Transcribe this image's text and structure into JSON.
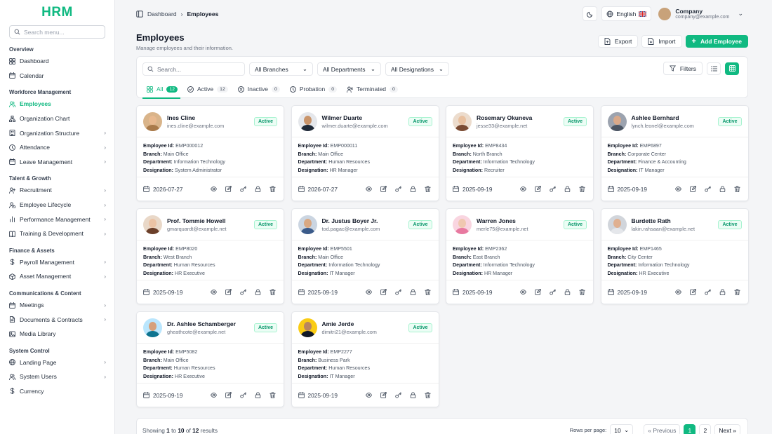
{
  "app": {
    "logo": "HRM"
  },
  "sidebar": {
    "search_placeholder": "Search menu...",
    "sections": [
      {
        "title": "Overview",
        "items": [
          {
            "label": "Dashboard",
            "icon": "dashboard-icon",
            "chevron": false
          },
          {
            "label": "Calendar",
            "icon": "calendar-icon",
            "chevron": false
          }
        ]
      },
      {
        "title": "Workforce Management",
        "items": [
          {
            "label": "Employees",
            "icon": "users-icon",
            "chevron": false,
            "active": true
          },
          {
            "label": "Organization Chart",
            "icon": "org-chart-icon",
            "chevron": false
          },
          {
            "label": "Organization Structure",
            "icon": "building-icon",
            "chevron": true
          },
          {
            "label": "Attendance",
            "icon": "clock-icon",
            "chevron": true
          },
          {
            "label": "Leave Management",
            "icon": "calendar-icon",
            "chevron": true
          }
        ]
      },
      {
        "title": "Talent & Growth",
        "items": [
          {
            "label": "Recruitment",
            "icon": "user-plus-icon",
            "chevron": true
          },
          {
            "label": "Employee Lifecycle",
            "icon": "user-cycle-icon",
            "chevron": true
          },
          {
            "label": "Performance Management",
            "icon": "bar-chart-icon",
            "chevron": true
          },
          {
            "label": "Training & Development",
            "icon": "book-icon",
            "chevron": true
          }
        ]
      },
      {
        "title": "Finance & Assets",
        "items": [
          {
            "label": "Payroll Management",
            "icon": "dollar-icon",
            "chevron": true
          },
          {
            "label": "Asset Management",
            "icon": "box-icon",
            "chevron": true
          }
        ]
      },
      {
        "title": "Communications & Content",
        "items": [
          {
            "label": "Meetings",
            "icon": "calendar-icon",
            "chevron": true
          },
          {
            "label": "Documents & Contracts",
            "icon": "file-icon",
            "chevron": true
          },
          {
            "label": "Media Library",
            "icon": "image-icon",
            "chevron": false
          }
        ]
      },
      {
        "title": "System Control",
        "items": [
          {
            "label": "Landing Page",
            "icon": "globe-icon",
            "chevron": true
          },
          {
            "label": "System Users",
            "icon": "users-icon",
            "chevron": true
          },
          {
            "label": "Currency",
            "icon": "dollar-icon",
            "chevron": false
          }
        ]
      }
    ]
  },
  "topbar": {
    "breadcrumb_root": "Dashboard",
    "breadcrumb_current": "Employees",
    "language": "English",
    "company_name": "Company",
    "company_email": "company@example.com"
  },
  "page": {
    "title": "Employees",
    "subtitle": "Manage employees and their information.",
    "export_label": "Export",
    "import_label": "Import",
    "add_label": "Add Employee"
  },
  "filters": {
    "search_placeholder": "Search...",
    "branches": "All Branches",
    "departments": "All Departments",
    "designations": "All Designations",
    "filters_label": "Filters"
  },
  "tabs": [
    {
      "label": "All",
      "count": "12",
      "icon": "grid-icon"
    },
    {
      "label": "Active",
      "count": "12",
      "icon": "check-circle-icon"
    },
    {
      "label": "Inactive",
      "count": "0",
      "icon": "x-circle-icon"
    },
    {
      "label": "Probation",
      "count": "0",
      "icon": "clock-icon"
    },
    {
      "label": "Terminated",
      "count": "0",
      "icon": "user-x-icon"
    }
  ],
  "labels": {
    "employee_id": "Employee Id:",
    "branch": "Branch:",
    "department": "Department:",
    "designation": "Designation:"
  },
  "employees": [
    {
      "name": "Ines Cline",
      "email": "ines.cline@example.com",
      "status": "Active",
      "id": "EMP000012",
      "branch": "Main Office",
      "department": "Information Technology",
      "designation": "System Administrator",
      "date": "2026-07-27",
      "skin": "#e8b98f",
      "shirt": "#a97a4a",
      "bg": "#d9b48a"
    },
    {
      "name": "Wilmer Duarte",
      "email": "wilmer.duarte@example.com",
      "status": "Active",
      "id": "EMP000011",
      "branch": "Main Office",
      "department": "Human Resources",
      "designation": "HR Manager",
      "date": "2026-07-27",
      "skin": "#c9946a",
      "shirt": "#1f2937",
      "bg": "#e5e7eb"
    },
    {
      "name": "Rosemary Okuneva",
      "email": "jesse33@example.net",
      "status": "Active",
      "id": "EMP8434",
      "branch": "North Branch",
      "department": "Information Technology",
      "designation": "Recruiter",
      "date": "2025-09-19",
      "skin": "#e9c1a0",
      "shirt": "#7a4a32",
      "bg": "#ecdccd"
    },
    {
      "name": "Ashlee Bernhard",
      "email": "lynch.leonel@example.com",
      "status": "Active",
      "id": "EMP6897",
      "branch": "Corporate Center",
      "department": "Finance & Accounting",
      "designation": "IT Manager",
      "date": "2025-09-19",
      "skin": "#d9a98a",
      "shirt": "#4b5563",
      "bg": "#9ca3af"
    },
    {
      "name": "Prof. Tommie Howell",
      "email": "gmarquardt@example.net",
      "status": "Active",
      "id": "EMP8020",
      "branch": "West Branch",
      "department": "Human Resources",
      "designation": "HR Executive",
      "date": "2025-09-19",
      "skin": "#ebc3a5",
      "shirt": "#6b3f2a",
      "bg": "#e9d8c8"
    },
    {
      "name": "Dr. Justus Boyer Jr.",
      "email": "tod.pagac@example.com",
      "status": "Active",
      "id": "EMP5501",
      "branch": "Main Office",
      "department": "Information Technology",
      "designation": "IT Manager",
      "date": "2025-09-19",
      "skin": "#d9a882",
      "shirt": "#3b5b8a",
      "bg": "#cbd5e1"
    },
    {
      "name": "Warren Jones",
      "email": "merle75@example.net",
      "status": "Active",
      "id": "EMP2362",
      "branch": "East Branch",
      "department": "Information Technology",
      "designation": "HR Manager",
      "date": "2025-09-19",
      "skin": "#f0c8b0",
      "shirt": "#e879a0",
      "bg": "#f9d5e0"
    },
    {
      "name": "Burdette Rath",
      "email": "lakin.rahsaan@example.net",
      "status": "Active",
      "id": "EMP1465",
      "branch": "City Center",
      "department": "Information Technology",
      "designation": "HR Executive",
      "date": "2025-09-19",
      "skin": "#e0b090",
      "shirt": "#e5e7eb",
      "bg": "#d1d5db"
    },
    {
      "name": "Dr. Ashlee Schamberger",
      "email": "gheathcote@example.net",
      "status": "Active",
      "id": "EMP5082",
      "branch": "Main Office",
      "department": "Human Resources",
      "designation": "HR Executive",
      "date": "2025-09-19",
      "skin": "#d6a07a",
      "shirt": "#0e7490",
      "bg": "#bae6fd"
    },
    {
      "name": "Amie Jerde",
      "email": "dimitri21@example.com",
      "status": "Active",
      "id": "EMP2277",
      "branch": "Business Park",
      "department": "Human Resources",
      "designation": "IT Manager",
      "date": "2025-09-19",
      "skin": "#b9865f",
      "shirt": "#111827",
      "bg": "#facc15"
    }
  ],
  "pagination": {
    "showing_prefix": "Showing",
    "from": "1",
    "to_word": "to",
    "to": "10",
    "of_word": "of",
    "total": "12",
    "suffix": "results",
    "rows_label": "Rows per page:",
    "rows_value": "10",
    "prev_label": "« Previous",
    "pages": [
      "1",
      "2"
    ],
    "next_label": "Next »"
  },
  "colors": {
    "accent": "#10b981"
  }
}
